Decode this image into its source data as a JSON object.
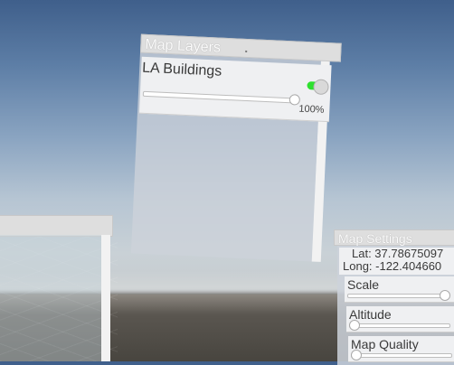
{
  "map_layers": {
    "title": "Map Layers",
    "layers": [
      {
        "name": "LA Buildings",
        "enabled": true,
        "opacity_label": "100%",
        "opacity": 1.0
      }
    ]
  },
  "map_settings": {
    "title": "Map Settings",
    "lat_label": "Lat: 37.78675097",
    "long_label": "Long: -122.404660",
    "controls": [
      {
        "label": "Scale",
        "value": 0.98
      },
      {
        "label": "Altitude",
        "value": 0.0
      },
      {
        "label": "Map Quality",
        "value": 0.0
      }
    ]
  },
  "colors": {
    "toggle_on": "#2ee02e",
    "panel_title_bg": "#dedede",
    "panel_body": "#cdd2da"
  }
}
